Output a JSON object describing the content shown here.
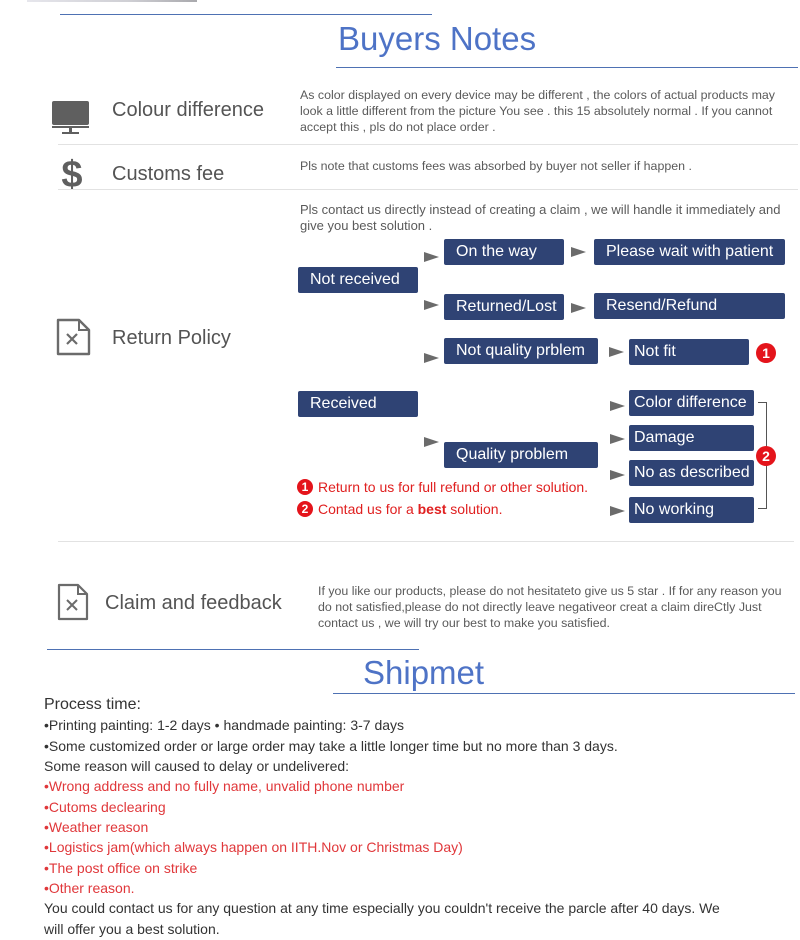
{
  "buyers_notes": {
    "title": "Buyers Notes",
    "sections": {
      "colour": {
        "label": "Colour difference",
        "icon": "monitor-icon",
        "text": "As color displayed on every device may be different , the colors of actual products may look a little different from the picture You see . this 15 absolutely normal . If you cannot accept this , pls do not place order ."
      },
      "customs": {
        "label": "Customs fee",
        "icon": "dollar-icon",
        "text": "Pls note that customs fees was absorbed by buyer not seller if happen ."
      },
      "return_policy": {
        "label": "Return Policy",
        "icon": "document-x-icon",
        "intro": "Pls contact us directly instead of creating a claim , we will handle it immediately and give you best solution .",
        "flow": {
          "not_received": "Not received",
          "on_the_way": "On the way",
          "please_wait": "Please wait with patient",
          "returned_lost": "Returned/Lost",
          "resend_refund": "Resend/Refund",
          "not_quality_problem": "Not quality prblem",
          "not_fit": "Not fit",
          "received": "Received",
          "quality_problem": "Quality problem",
          "color_difference": "Color difference",
          "damage": "Damage",
          "no_as_described": "No as described",
          "no_working": "No working",
          "badge_1": "1",
          "badge_2": "2"
        },
        "notes": [
          {
            "num": "1",
            "text": "Return to us for full refund or other solution."
          },
          {
            "num": "2",
            "text_a": "Contad us for a ",
            "text_b": "best",
            "text_c": " solution."
          }
        ]
      },
      "claim": {
        "label": "Claim and feedback",
        "icon": "document-x-icon",
        "text": "If you like our products,  please do not hesitateto give us 5 star . If for any reason you do not satisfied,please do not directly leave negativeor creat a claim direCtly Just contact us , we will try our best to make you satisfied."
      }
    }
  },
  "shipment": {
    "title": "Shipmet",
    "process_heading": "Process time:",
    "process_lines": [
      "•Printing painting: 1-2 days • handmade painting: 3-7 days",
      "•Some customized order or large order may take a little longer time but no more than 3 days."
    ],
    "delay_heading": "Some reason will caused to delay or undelivered:",
    "delay_reasons": [
      "•Wrong address and no fully name, unvalid phone number",
      "•Cutoms declearing",
      "•Weather reason",
      "•Logistics jam(which always happen on IITH.Nov or Christmas Day)",
      "•The post office on strike",
      "•Other reason."
    ],
    "closing": [
      "You could contact us for any question at any time especially you couldn't receive the parcle after 40 days. We",
      "will offer you a best solution."
    ]
  }
}
